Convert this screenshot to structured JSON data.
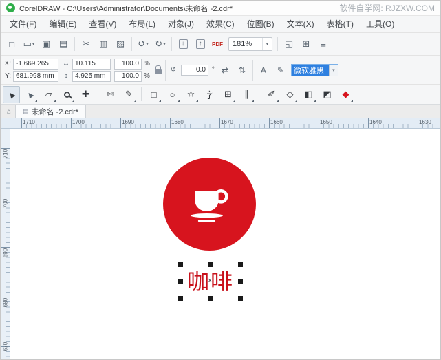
{
  "titlebar": {
    "title": "CorelDRAW - C:\\Users\\Administrator\\Documents\\未命名 -2.cdr*",
    "watermark": "软件自学网: RJZXW.COM"
  },
  "menubar": {
    "items": [
      {
        "label": "文件(F)"
      },
      {
        "label": "编辑(E)"
      },
      {
        "label": "查看(V)"
      },
      {
        "label": "布局(L)"
      },
      {
        "label": "对象(J)"
      },
      {
        "label": "效果(C)"
      },
      {
        "label": "位图(B)"
      },
      {
        "label": "文本(X)"
      },
      {
        "label": "表格(T)"
      },
      {
        "label": "工具(O)"
      }
    ]
  },
  "icons": {
    "dropdown": "▾",
    "h_arrow": "↔",
    "v_arrow": "↕",
    "rotate": "↺"
  },
  "toolbar": {
    "zoom_level": "181%",
    "pdf_label": "PDF",
    "items": [
      {
        "name": "new-document",
        "glyph": "□"
      },
      {
        "name": "open",
        "glyph": "▭"
      },
      {
        "name": "save",
        "glyph": "▣"
      },
      {
        "name": "print",
        "glyph": "▤"
      },
      {
        "name": "cut",
        "glyph": "✂"
      },
      {
        "name": "copy",
        "glyph": "▥"
      },
      {
        "name": "paste",
        "glyph": "▨"
      },
      {
        "name": "undo",
        "glyph": "↺"
      },
      {
        "name": "redo",
        "glyph": "↻"
      },
      {
        "name": "import",
        "glyph": "↓"
      },
      {
        "name": "export",
        "glyph": "↑"
      },
      {
        "name": "fullscreen-preview",
        "glyph": "◱"
      },
      {
        "name": "show-grid",
        "glyph": "⊞"
      },
      {
        "name": "options",
        "glyph": "≡"
      }
    ]
  },
  "property_bar": {
    "x_label": "X:",
    "y_label": "Y:",
    "x_value": "-1,669.265 mm",
    "y_value": "681.998 mm",
    "width_value": "10.115 mm",
    "height_value": "4.925 mm",
    "scale_x_value": "100.0",
    "scale_y_value": "100.0",
    "percent_label": "%",
    "angle_value": "0.0",
    "angle_unit": "°",
    "mirror_h_glyph": "⇄",
    "mirror_v_glyph": "⇅",
    "char_format_glyph": "A",
    "edit_text_glyph": "✎",
    "font_name": "微软雅黑"
  },
  "toolbox": {
    "items": [
      {
        "name": "pick-tool",
        "glyph": "▲"
      },
      {
        "name": "shape-tool",
        "glyph": "▲"
      },
      {
        "name": "crop-tool",
        "glyph": "▱"
      },
      {
        "name": "pan-tool",
        "glyph": "✚"
      },
      {
        "name": "knife-tool",
        "glyph": "✄"
      },
      {
        "name": "freehand-tool",
        "glyph": "✎"
      },
      {
        "name": "rectangle-tool",
        "glyph": "□"
      },
      {
        "name": "ellipse-tool",
        "glyph": "○"
      },
      {
        "name": "polygon-tool",
        "glyph": "☆"
      },
      {
        "name": "text-tool",
        "glyph": "字"
      },
      {
        "name": "table-tool",
        "glyph": "⊞"
      },
      {
        "name": "parallel-line-tool",
        "glyph": "∥"
      },
      {
        "name": "eyedropper-tool",
        "glyph": "✐"
      },
      {
        "name": "outline-pen-tool",
        "glyph": "◇"
      },
      {
        "name": "interactive-fill-tool",
        "glyph": "◧"
      },
      {
        "name": "smart-fill-tool",
        "glyph": "◩"
      },
      {
        "name": "fill-color-tool",
        "glyph": "◆"
      }
    ]
  },
  "tabbar": {
    "home_glyph": "⌂",
    "page_glyph": "▤",
    "document_tab": "未命名 -2.cdr*"
  },
  "rulers": {
    "horizontal_labels": [
      "1710",
      "1700",
      "1690",
      "1680",
      "1670",
      "1660",
      "1650",
      "1640",
      "1630"
    ],
    "vertical_labels": [
      "710",
      "700",
      "690",
      "680",
      "670"
    ]
  },
  "canvas": {
    "logo_text": "咖啡",
    "center_marker": "×",
    "logo_circle_color": "#d7141e",
    "logo_text_color": "#c8101a"
  }
}
